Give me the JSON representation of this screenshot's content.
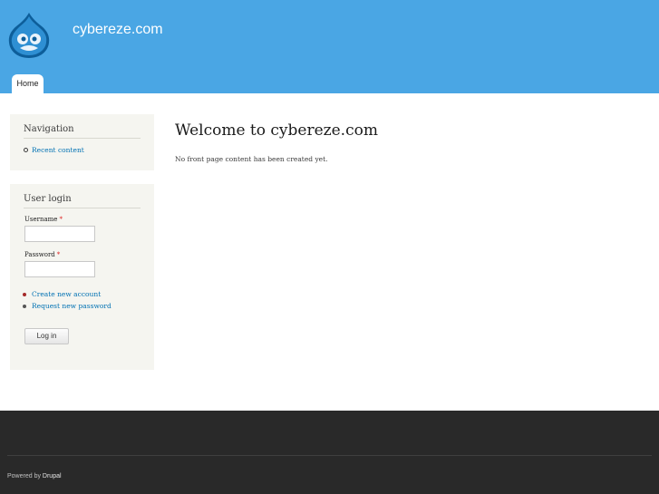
{
  "header": {
    "site_name": "cybereze.com",
    "logo_icon": "drupal-drop-logo",
    "tabs": [
      {
        "label": "Home",
        "active": true
      }
    ]
  },
  "sidebar": {
    "navigation": {
      "title": "Navigation",
      "items": [
        {
          "label": "Recent content"
        }
      ]
    },
    "user_login": {
      "title": "User login",
      "username_label": "Username",
      "password_label": "Password",
      "required_marker": "*",
      "username_value": "",
      "password_value": "",
      "links": [
        {
          "label": "Create new account"
        },
        {
          "label": "Request new password"
        }
      ],
      "submit_label": "Log in"
    }
  },
  "main": {
    "title": "Welcome to cybereze.com",
    "body": "No front page content has been created yet."
  },
  "footer": {
    "prefix": "Powered by",
    "link": "Drupal"
  },
  "colors": {
    "header": "#4aa6e4",
    "footer": "#292929",
    "link": "#0071b3",
    "sidebar_block": "#f5f5f0"
  }
}
